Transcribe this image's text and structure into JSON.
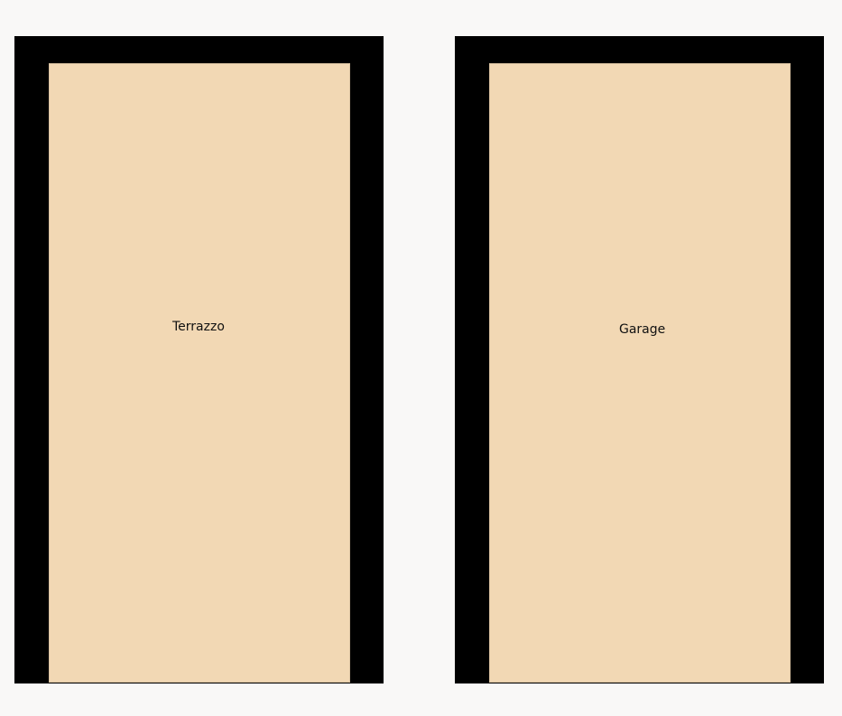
{
  "rooms": [
    {
      "label": "Terrazzo"
    },
    {
      "label": "Garage"
    }
  ],
  "colors": {
    "background": "#f9f8f7",
    "wall": "#000000",
    "floor": "#f2d8b4"
  }
}
